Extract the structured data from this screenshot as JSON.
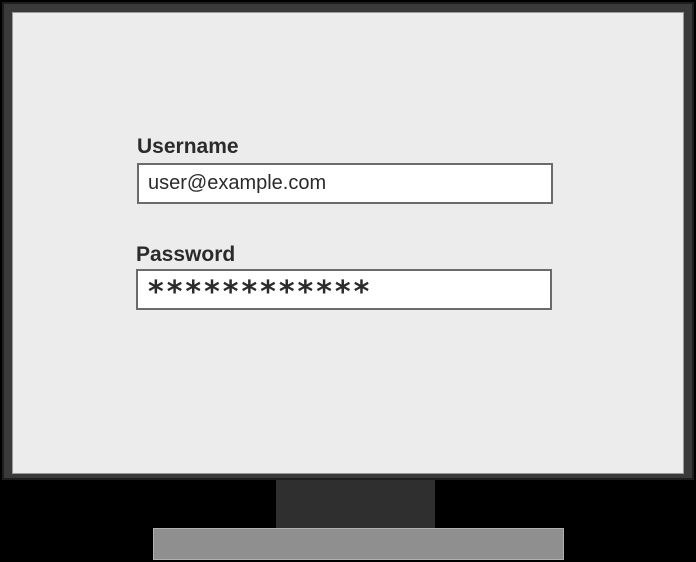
{
  "login_form": {
    "username": {
      "label": "Username",
      "value": "user@example.com"
    },
    "password": {
      "label": "Password",
      "masked_value": "************"
    }
  },
  "colors": {
    "screen_background": "#ebeceb",
    "monitor_bezel": "#3a3a3a",
    "stand_neck": "#2f2f2f",
    "stand_base": "#8f8f8f",
    "input_background": "#ffffff",
    "text": "#2b2b2b"
  }
}
